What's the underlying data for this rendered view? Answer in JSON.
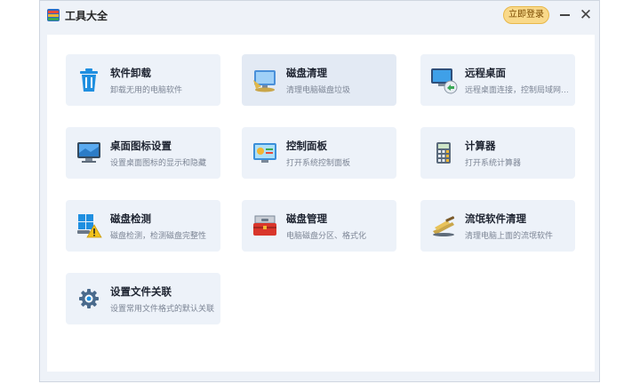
{
  "window": {
    "title": "工具大全",
    "login_label": "立即登录",
    "minimize_glyph": "—",
    "close_glyph": "✕"
  },
  "tools": [
    {
      "title": "软件卸载",
      "desc": "卸载无用的电脑软件",
      "icon": "trash-icon"
    },
    {
      "title": "磁盘清理",
      "desc": "清理电脑磁盘垃圾",
      "icon": "disk-clean-icon"
    },
    {
      "title": "远程桌面",
      "desc": "远程桌面连接，控制局域网…",
      "icon": "remote-desktop-icon"
    },
    {
      "title": "桌面图标设置",
      "desc": "设置桌面图标的显示和隐藏",
      "icon": "desktop-monitor-icon"
    },
    {
      "title": "控制面板",
      "desc": "打开系统控制面板",
      "icon": "control-panel-icon"
    },
    {
      "title": "计算器",
      "desc": "打开系统计算器",
      "icon": "calculator-icon"
    },
    {
      "title": "磁盘检测",
      "desc": "磁盘检测，检测磁盘完整性",
      "icon": "disk-check-icon"
    },
    {
      "title": "磁盘管理",
      "desc": "电脑磁盘分区、格式化",
      "icon": "toolbox-icon"
    },
    {
      "title": "流氓软件清理",
      "desc": "清理电脑上面的流氓软件",
      "icon": "broom-icon"
    },
    {
      "title": "设置文件关联",
      "desc": "设置常用文件格式的默认关联",
      "icon": "gear-icon"
    }
  ],
  "colors": {
    "accent": "#1f8fe0",
    "login_bg": "#f9d98a",
    "tile_bg": "#edf2f9"
  }
}
